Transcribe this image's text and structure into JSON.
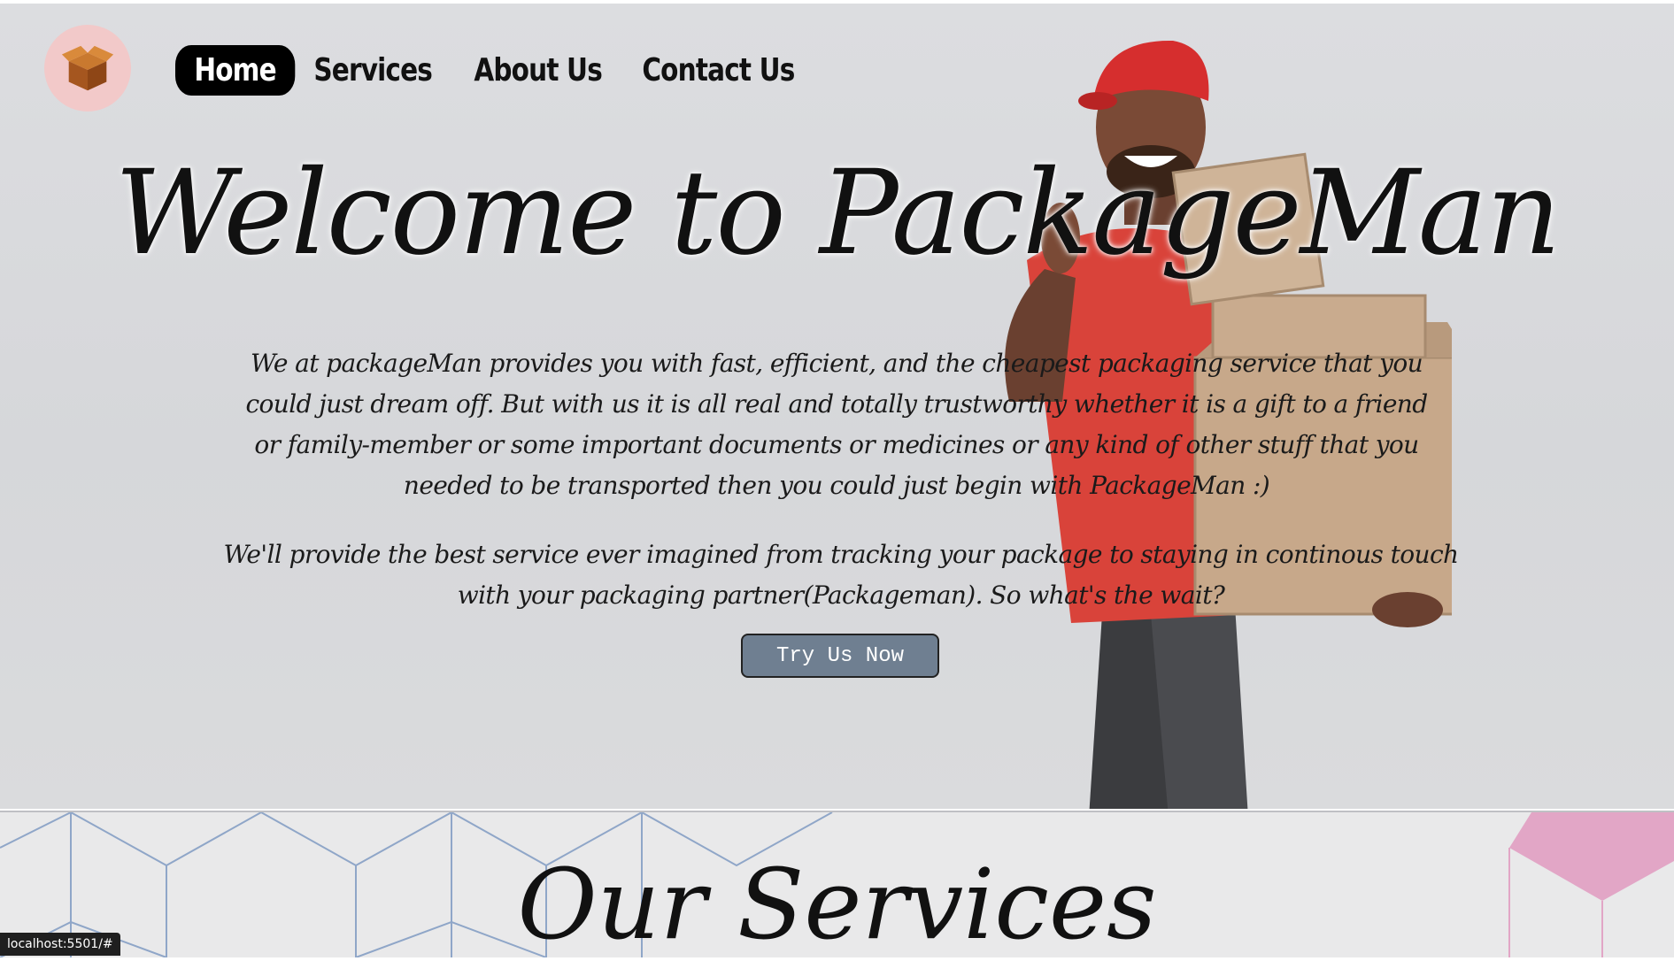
{
  "nav": {
    "logo_icon": "box-icon",
    "links": [
      {
        "label": "Home",
        "active": true
      },
      {
        "label": "Services",
        "active": false
      },
      {
        "label": "About Us",
        "active": false
      },
      {
        "label": "Contact Us",
        "active": false
      }
    ]
  },
  "hero": {
    "headline": "Welcome to PackageMan",
    "paragraph1": "We at packageMan provides you with fast, efficient, and the cheapest packaging service that you could just dream off. But with us it is all real and totally trustworthy whether it is a gift to a friend or family-member or some important documents or medicines or any kind of other stuff that you needed to be transported then you could just begin with PackageMan :)",
    "paragraph2": "We'll provide the best service ever imagined from tracking your package to staying in continous touch with your packaging partner(Packageman). So what's the wait?",
    "cta_label": "Try Us Now"
  },
  "services": {
    "title": "Our Services"
  },
  "status_bar": {
    "url": "localhost:5501/#"
  },
  "colors": {
    "cta_bg": "#6f7f91",
    "logo_bg": "#f2c9c9",
    "hex_pink": "#e2a6c6",
    "hex_line": "#8fa6c8"
  }
}
